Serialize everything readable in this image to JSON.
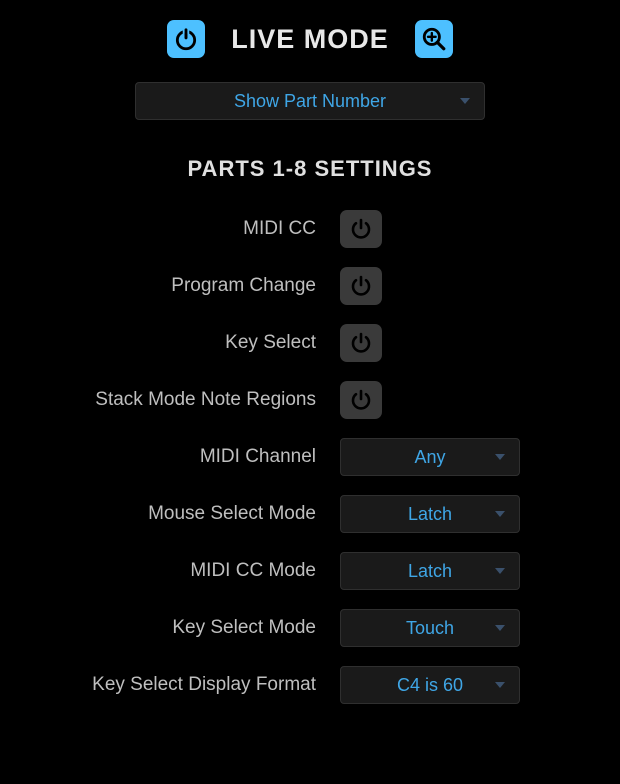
{
  "header": {
    "title": "LIVE MODE",
    "power_on": true
  },
  "top_dropdown": {
    "label": "Show Part Number"
  },
  "section_title": "PARTS 1-8 SETTINGS",
  "rows": [
    {
      "label": "MIDI CC",
      "type": "toggle",
      "on": false
    },
    {
      "label": "Program Change",
      "type": "toggle",
      "on": false
    },
    {
      "label": "Key Select",
      "type": "toggle",
      "on": false
    },
    {
      "label": "Stack Mode Note Regions",
      "type": "toggle",
      "on": false
    },
    {
      "label": "MIDI Channel",
      "type": "dropdown",
      "value": "Any"
    },
    {
      "label": "Mouse Select Mode",
      "type": "dropdown",
      "value": "Latch"
    },
    {
      "label": "MIDI CC Mode",
      "type": "dropdown",
      "value": "Latch"
    },
    {
      "label": "Key Select Mode",
      "type": "dropdown",
      "value": "Touch"
    },
    {
      "label": "Key Select Display Format",
      "type": "dropdown",
      "value": "C4 is 60"
    }
  ],
  "colors": {
    "accent": "#4dc0ff",
    "dropdown_text": "#3fa6e6",
    "caret": "#3a506b"
  }
}
